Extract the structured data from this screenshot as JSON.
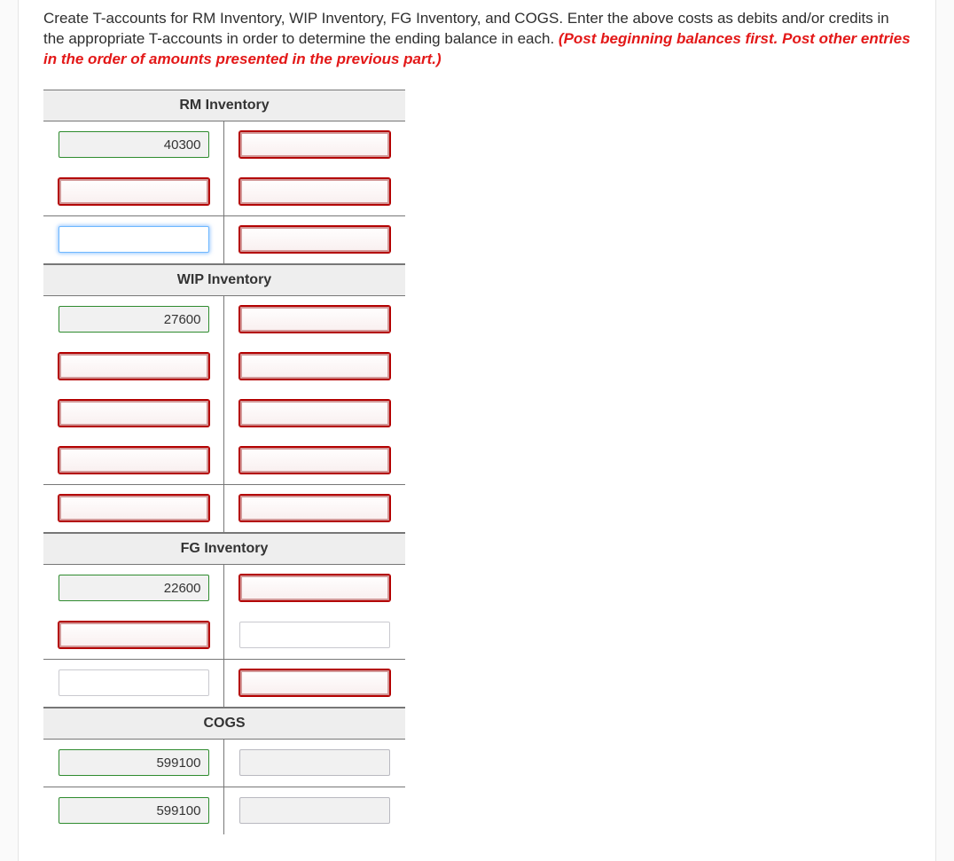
{
  "instruction": {
    "main": "Create T-accounts for RM Inventory, WIP Inventory, FG Inventory, and COGS. Enter the above costs as debits and/or credits in the appropriate T-accounts in order to determine the ending balance in each. ",
    "emph": "(Post beginning balances first. Post other entries in the order of amounts presented in the previous part.)"
  },
  "accounts": [
    {
      "title": "RM Inventory",
      "body_rows": [
        {
          "debit": {
            "style": "correct",
            "value": "40300"
          },
          "credit": {
            "style": "wrong",
            "value": ""
          }
        },
        {
          "debit": {
            "style": "wrong",
            "value": ""
          },
          "credit": {
            "style": "wrong",
            "value": ""
          }
        }
      ],
      "total_rows": [
        {
          "debit": {
            "style": "active",
            "value": ""
          },
          "credit": {
            "style": "wrong",
            "value": ""
          }
        }
      ]
    },
    {
      "title": "WIP Inventory",
      "body_rows": [
        {
          "debit": {
            "style": "correct",
            "value": "27600"
          },
          "credit": {
            "style": "wrong",
            "value": ""
          }
        },
        {
          "debit": {
            "style": "wrong",
            "value": ""
          },
          "credit": {
            "style": "wrong",
            "value": ""
          }
        },
        {
          "debit": {
            "style": "wrong",
            "value": ""
          },
          "credit": {
            "style": "wrong",
            "value": ""
          }
        },
        {
          "debit": {
            "style": "wrong",
            "value": ""
          },
          "credit": {
            "style": "wrong",
            "value": ""
          }
        }
      ],
      "total_rows": [
        {
          "debit": {
            "style": "wrong",
            "value": ""
          },
          "credit": {
            "style": "wrong",
            "value": ""
          }
        }
      ]
    },
    {
      "title": "FG Inventory",
      "body_rows": [
        {
          "debit": {
            "style": "correct",
            "value": "22600"
          },
          "credit": {
            "style": "wrong",
            "value": ""
          }
        },
        {
          "debit": {
            "style": "wrong",
            "value": ""
          },
          "credit": {
            "style": "plain",
            "value": ""
          }
        }
      ],
      "total_rows": [
        {
          "debit": {
            "style": "plain",
            "value": ""
          },
          "credit": {
            "style": "wrong",
            "value": ""
          }
        }
      ]
    },
    {
      "title": "COGS",
      "body_rows": [
        {
          "debit": {
            "style": "correct",
            "value": "599100"
          },
          "credit": {
            "style": "correct-gray",
            "value": ""
          }
        }
      ],
      "total_rows": [
        {
          "debit": {
            "style": "correct",
            "value": "599100"
          },
          "credit": {
            "style": "correct-gray",
            "value": ""
          }
        }
      ]
    }
  ]
}
